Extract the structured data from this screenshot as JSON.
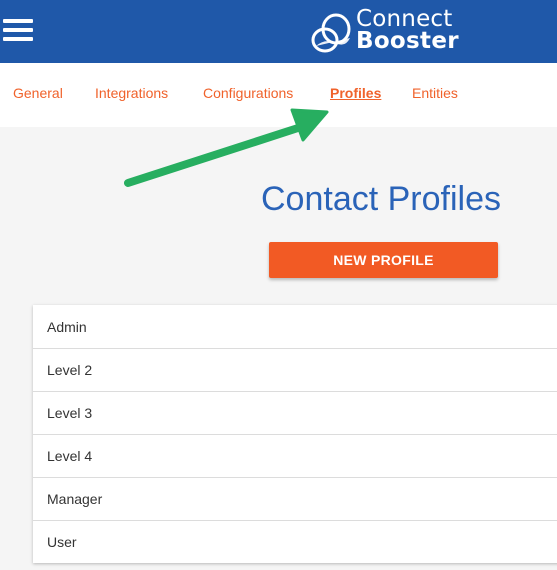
{
  "header": {
    "menu_icon": "hamburger-menu-icon",
    "logo_mark_icon": "connectbooster-logo-icon",
    "logo_line1": "Connect",
    "logo_line2": "Booster",
    "brand_color": "#1f58a9"
  },
  "tabs": [
    {
      "label": "General",
      "active": false
    },
    {
      "label": "Integrations",
      "active": false
    },
    {
      "label": "Configurations",
      "active": false
    },
    {
      "label": "Profiles",
      "active": true
    },
    {
      "label": "Entities",
      "active": false
    }
  ],
  "annotation": {
    "arrow_icon": "green-arrow-icon",
    "arrow_color": "#27ae60"
  },
  "main": {
    "title": "Contact Profiles",
    "new_button_label": "NEW PROFILE",
    "accent_color": "#f25a24"
  },
  "profiles": [
    "Admin",
    "Level 2",
    "Level 3",
    "Level 4",
    "Manager",
    "User"
  ]
}
